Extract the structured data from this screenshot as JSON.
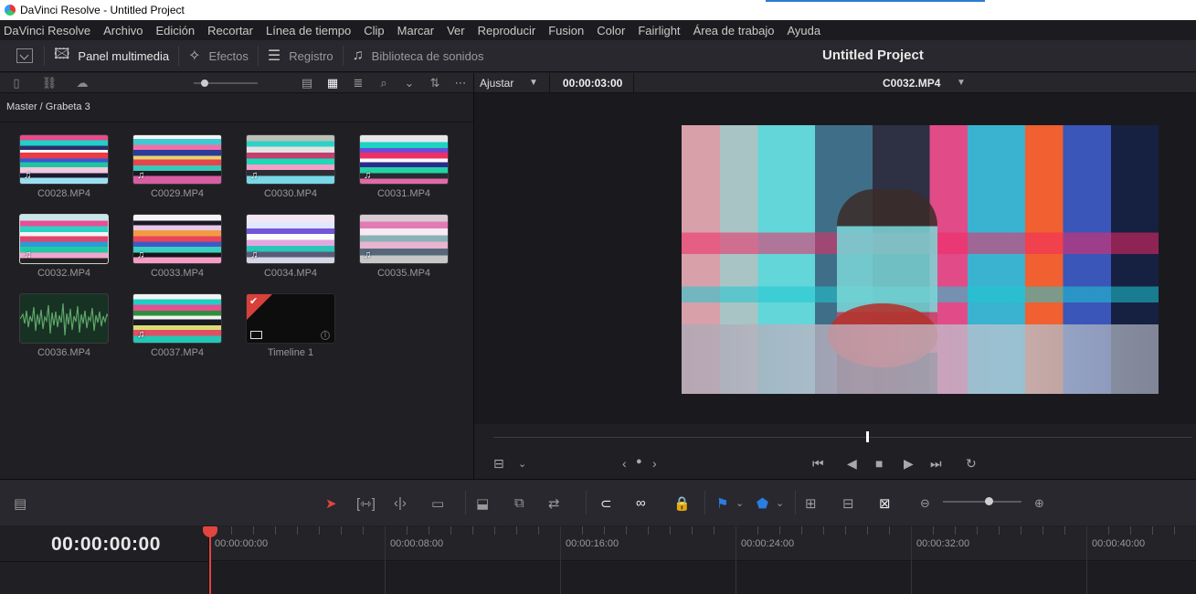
{
  "window": {
    "title": "DaVinci Resolve - Untitled Project"
  },
  "menu": [
    "DaVinci Resolve",
    "Archivo",
    "Edición",
    "Recortar",
    "Línea de tiempo",
    "Clip",
    "Marcar",
    "Ver",
    "Reproducir",
    "Fusion",
    "Color",
    "Fairlight",
    "Área de trabajo",
    "Ayuda"
  ],
  "toolbar": {
    "media_pool": "Panel multimedia",
    "effects": "Efectos",
    "log": "Registro",
    "sound_library": "Biblioteca de sonidos",
    "project_title": "Untitled Project"
  },
  "media_pool": {
    "breadcrumb": "Master / Grabeta 3",
    "clips": [
      {
        "name": "C0028.MP4",
        "kind": "video"
      },
      {
        "name": "C0029.MP4",
        "kind": "video"
      },
      {
        "name": "C0030.MP4",
        "kind": "video"
      },
      {
        "name": "C0031.MP4",
        "kind": "video"
      },
      {
        "name": "C0032.MP4",
        "kind": "video"
      },
      {
        "name": "C0033.MP4",
        "kind": "video"
      },
      {
        "name": "C0034.MP4",
        "kind": "video"
      },
      {
        "name": "C0035.MP4",
        "kind": "video"
      },
      {
        "name": "C0036.MP4",
        "kind": "audio"
      },
      {
        "name": "C0037.MP4",
        "kind": "video"
      },
      {
        "name": "Timeline 1",
        "kind": "timeline"
      }
    ]
  },
  "viewer": {
    "zoom": "Ajustar",
    "timecode": "00:00:03:00",
    "clip_name": "C0032.MP4",
    "scrub_position": 0.535
  },
  "timeline": {
    "current_timecode": "00:00:00:00",
    "ruler_labels": [
      "00:00:00:00",
      "00:00:08:00",
      "00:00:16:00",
      "00:00:24:00",
      "00:00:32:00",
      "00:00:40:00"
    ],
    "zoom_level": 0.55
  },
  "icons": {
    "music": "♫",
    "check": "✔"
  },
  "colors": {
    "accent_red": "#e0453e",
    "flag_blue": "#2b7de0"
  }
}
